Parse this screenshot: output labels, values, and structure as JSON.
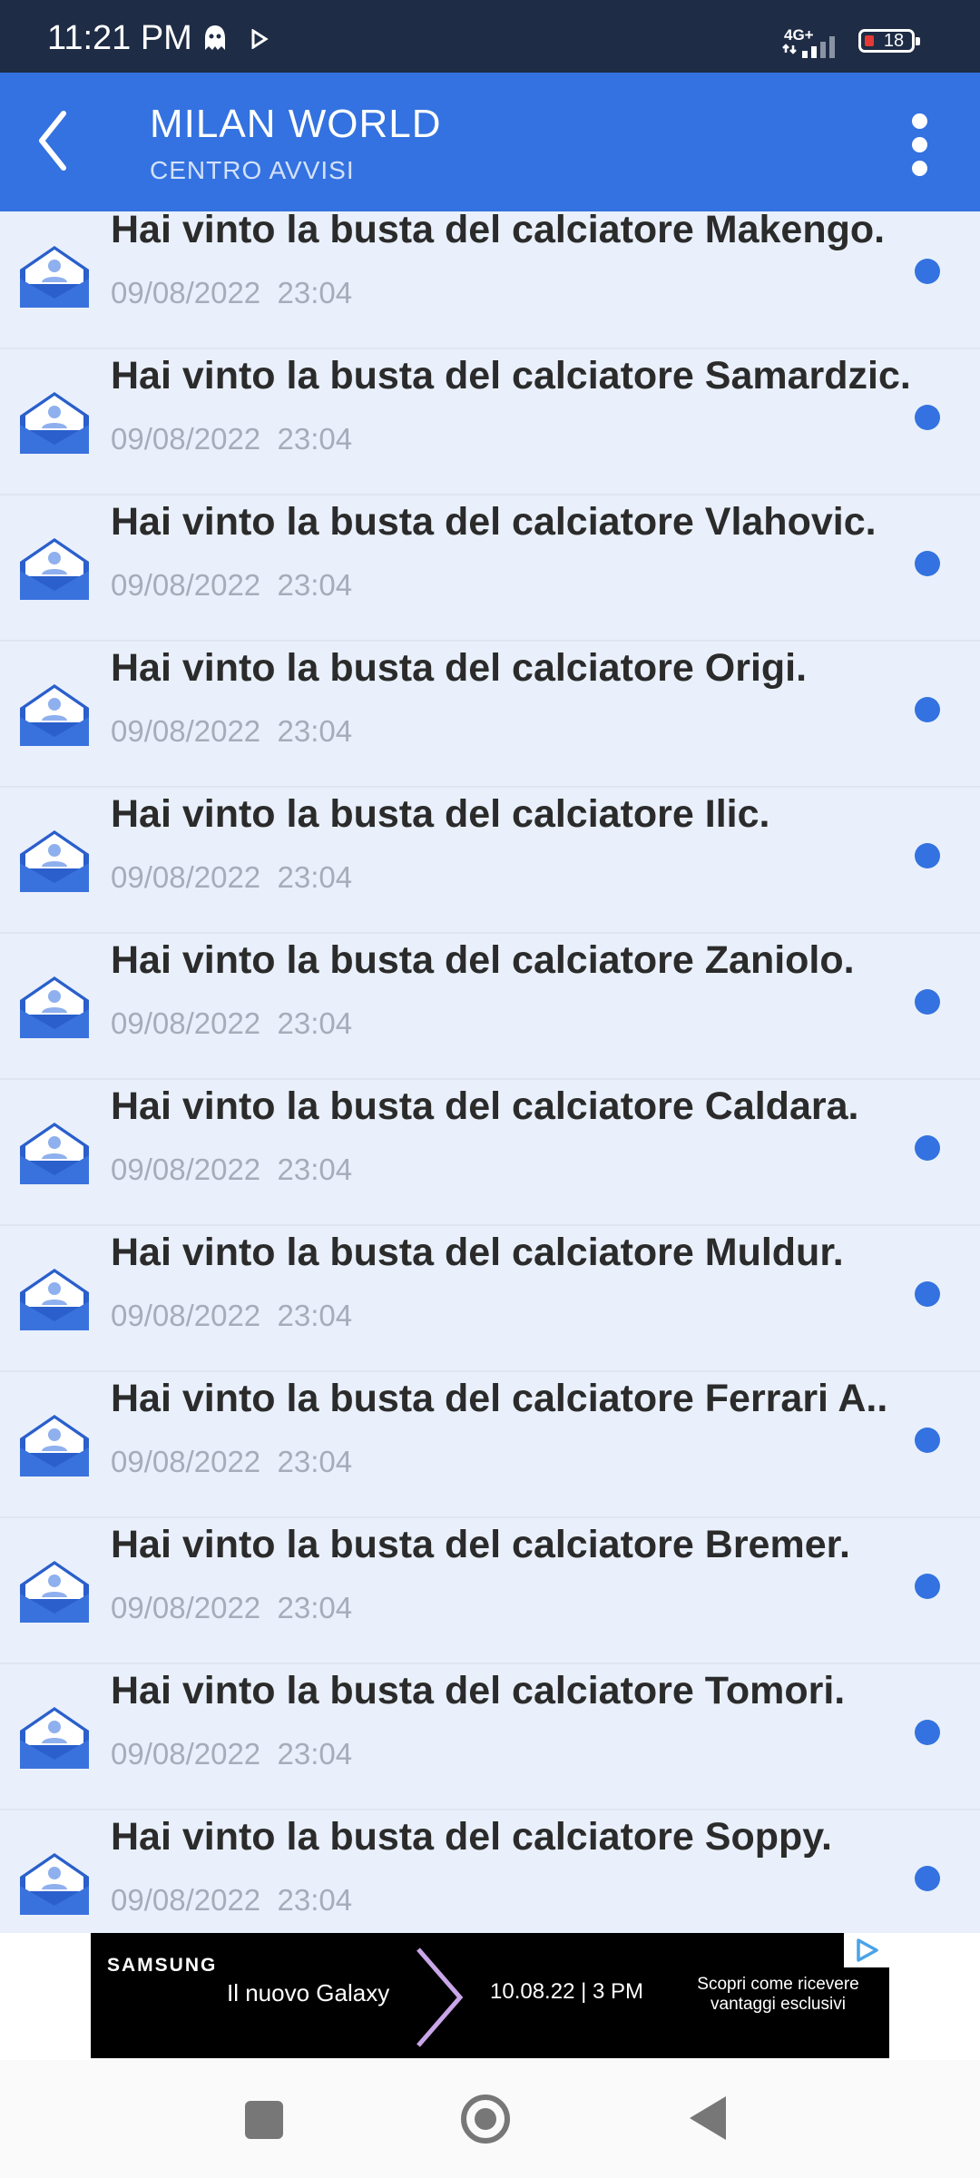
{
  "status_bar": {
    "time": "11:21 PM",
    "network": "4G+",
    "battery": "18",
    "icons": [
      "ghost-icon",
      "play-icon",
      "signal-icon",
      "battery-icon"
    ]
  },
  "app_bar": {
    "title": "MILAN WORLD",
    "subtitle": "CENTRO AVVISI",
    "icons": [
      "back-icon",
      "more-vertical-icon"
    ]
  },
  "notifications": [
    {
      "message": "Hai vinto la busta del calciatore Makengo.",
      "date": "09/08/2022  23:04",
      "unread": true
    },
    {
      "message": "Hai vinto la busta del calciatore Samardzic.",
      "date": "09/08/2022  23:04",
      "unread": true
    },
    {
      "message": "Hai vinto la busta del calciatore Vlahovic.",
      "date": "09/08/2022  23:04",
      "unread": true
    },
    {
      "message": "Hai vinto la busta del calciatore Origi.",
      "date": "09/08/2022  23:04",
      "unread": true
    },
    {
      "message": "Hai vinto la busta del calciatore Ilic.",
      "date": "09/08/2022  23:04",
      "unread": true
    },
    {
      "message": "Hai vinto la busta del calciatore Zaniolo.",
      "date": "09/08/2022  23:04",
      "unread": true
    },
    {
      "message": "Hai vinto la busta del calciatore Caldara.",
      "date": "09/08/2022  23:04",
      "unread": true
    },
    {
      "message": "Hai vinto la busta del calciatore Muldur.",
      "date": "09/08/2022  23:04",
      "unread": true
    },
    {
      "message": "Hai vinto la busta del calciatore Ferrari A..",
      "date": "09/08/2022  23:04",
      "unread": true
    },
    {
      "message": "Hai vinto la busta del calciatore Bremer.",
      "date": "09/08/2022  23:04",
      "unread": true
    },
    {
      "message": "Hai vinto la busta del calciatore Tomori.",
      "date": "09/08/2022  23:04",
      "unread": true
    },
    {
      "message": "Hai vinto la busta del calciatore Soppy.",
      "date": "09/08/2022  23:04",
      "unread": true
    }
  ],
  "ad": {
    "brand": "SAMSUNG",
    "headline": "Il nuovo Galaxy",
    "date": "10.08.22 | 3 PM",
    "cta": "Scopri come ricevere vantaggi esclusivi"
  },
  "colors": {
    "status_bar": "#1e2c45",
    "app_bar": "#3372e0",
    "list_background": "#e9f0fb",
    "unread_dot": "#3372e0",
    "envelope": "#2f63cf"
  }
}
